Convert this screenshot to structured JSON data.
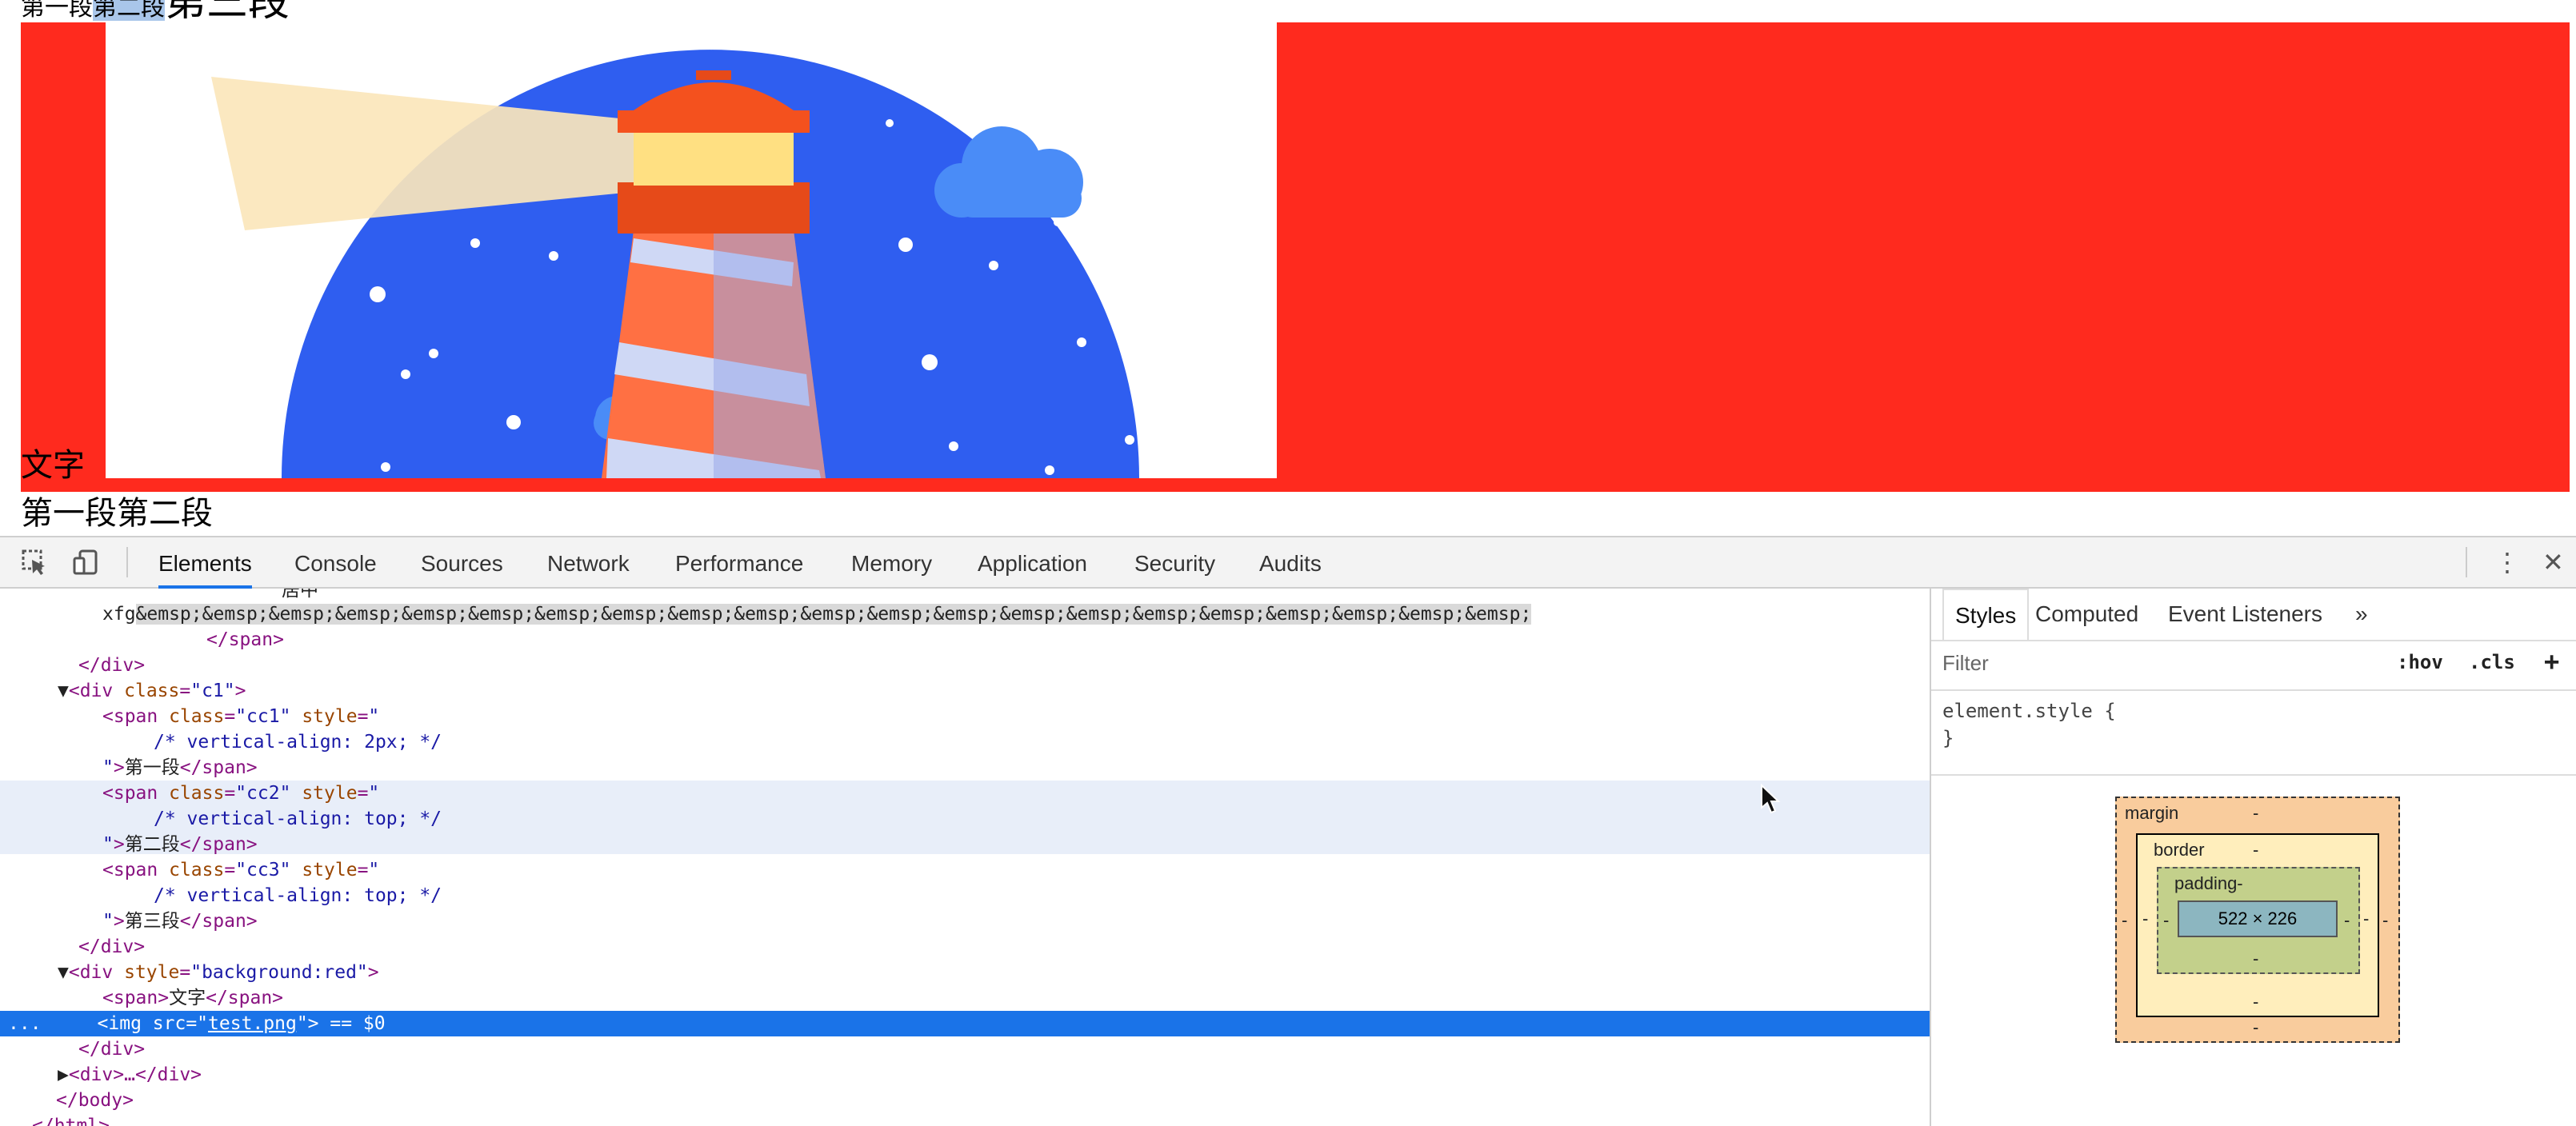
{
  "page": {
    "top_line": [
      "第一段",
      "第二段",
      "第三段"
    ],
    "red_div_text": "文字",
    "bottom_line": "第一段第二段"
  },
  "devtools": {
    "tabs": [
      "Elements",
      "Console",
      "Sources",
      "Network",
      "Performance",
      "Memory",
      "Application",
      "Security",
      "Audits"
    ],
    "active_tab": "Elements",
    "elements_lines": {
      "l0": "居中",
      "l1_prefix": "xfg",
      "l1_emsp": "&emsp;&emsp;&emsp;&emsp;&emsp;&emsp;&emsp;&emsp;&emsp;&emsp;&emsp;&emsp;&emsp;&emsp;&emsp;&emsp;&emsp;&emsp;&emsp;&emsp;&emsp;",
      "l2": "</span>",
      "l3": "</div>",
      "l4_tag": "div",
      "l4_attr": "class",
      "l4_val": "\"c1\"",
      "cc1_val": "\"cc1\"",
      "cc1_comment": "/* vertical-align: 2px; */",
      "cc1_text": "第一段",
      "cc2_val": "\"cc2\"",
      "cc2_comment": "/* vertical-align: top; */",
      "cc2_text": "第二段",
      "cc3_val": "\"cc3\"",
      "cc3_comment": "/* vertical-align: top; */",
      "cc3_text": "第三段",
      "style_val": "\"background:red\"",
      "span_text": "文字",
      "img_src": "test.png",
      "selected_suffix": " == $0",
      "collapsed_div": "<div>…</div>",
      "body_close": "</body>",
      "html_close": "</html>"
    },
    "styles_panel": {
      "tabs": [
        "Styles",
        "Computed",
        "Event Listeners"
      ],
      "more": "»",
      "filter_placeholder": "Filter",
      "hov": ":hov",
      "cls": ".cls",
      "plus": "+",
      "element_style": "element.style {",
      "close_brace": "}",
      "box_model": {
        "margin_label": "margin",
        "border_label": "border",
        "padding_label": "padding-",
        "content_size": "522 × 226",
        "dash": "-"
      }
    }
  },
  "colors": {
    "red": "#ff2a1e",
    "selection": "#1a73e8",
    "sky": "#2f5ef0"
  }
}
